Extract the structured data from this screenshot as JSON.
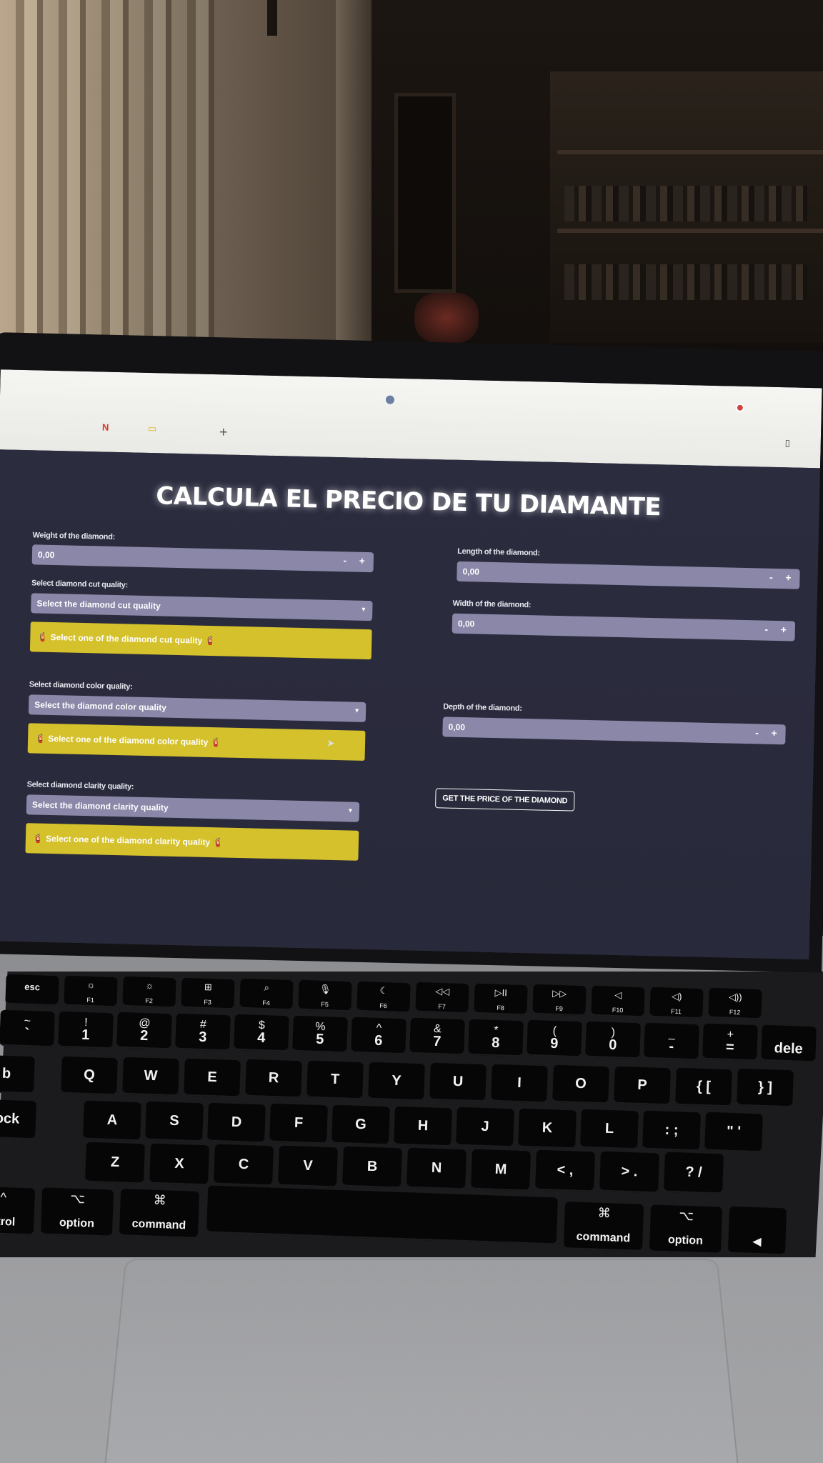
{
  "browser": {
    "tab_icon_1": "N",
    "tab_icon_2": "▭",
    "new_tab": "+",
    "toolbar_end": "▯"
  },
  "app": {
    "title": "CALCULA EL PRECIO DE TU DIAMANTE",
    "weight": {
      "label": "Weight of the diamond:",
      "value": "0,00"
    },
    "cut": {
      "label": "Select diamond cut quality:",
      "placeholder": "Select the diamond cut quality",
      "warning": "Select one of the diamond cut quality"
    },
    "color": {
      "label": "Select diamond color quality:",
      "placeholder": "Select the diamond color quality",
      "warning": "Select one of the diamond color quality"
    },
    "clarity": {
      "label": "Select diamond clarity quality:",
      "placeholder": "Select the diamond clarity quality",
      "warning": "Select one of the diamond clarity quality"
    },
    "length": {
      "label": "Length of the diamond:",
      "value": "0,00"
    },
    "width": {
      "label": "Width of the diamond:",
      "value": "0,00"
    },
    "depth": {
      "label": "Depth of the diamond:",
      "value": "0,00"
    },
    "stepper": {
      "minus": "-",
      "plus": "+"
    },
    "chevron": "▾",
    "button": "GET THE PRICE OF THE DIAMOND",
    "warning_icon": "🧯"
  },
  "keyboard": {
    "fn_row": [
      {
        "label": "esc",
        "sub": ""
      },
      {
        "label": "☼",
        "sub": "F1"
      },
      {
        "label": "☼",
        "sub": "F2"
      },
      {
        "label": "⊞",
        "sub": "F3"
      },
      {
        "label": "⌕",
        "sub": "F4"
      },
      {
        "label": "🎙",
        "sub": "F5"
      },
      {
        "label": "☾",
        "sub": "F6"
      },
      {
        "label": "◁◁",
        "sub": "F7"
      },
      {
        "label": "▷II",
        "sub": "F8"
      },
      {
        "label": "▷▷",
        "sub": "F9"
      },
      {
        "label": "◁",
        "sub": "F10"
      },
      {
        "label": "◁)",
        "sub": "F11"
      },
      {
        "label": "◁))",
        "sub": "F12"
      }
    ],
    "num_row": [
      {
        "top": "~",
        "bot": "`"
      },
      {
        "top": "!",
        "bot": "1"
      },
      {
        "top": "@",
        "bot": "2"
      },
      {
        "top": "#",
        "bot": "3"
      },
      {
        "top": "$",
        "bot": "4"
      },
      {
        "top": "%",
        "bot": "5"
      },
      {
        "top": "^",
        "bot": "6"
      },
      {
        "top": "&",
        "bot": "7"
      },
      {
        "top": "*",
        "bot": "8"
      },
      {
        "top": "(",
        "bot": "9"
      },
      {
        "top": ")",
        "bot": "0"
      },
      {
        "top": "_",
        "bot": "-"
      },
      {
        "top": "+",
        "bot": "="
      },
      {
        "top": "",
        "bot": "dele"
      }
    ],
    "row_q": [
      "b",
      "Q",
      "W",
      "E",
      "R",
      "T",
      "Y",
      "U",
      "I",
      "O",
      "P",
      "{ [",
      "} ]"
    ],
    "row_a": [
      "ock",
      "A",
      "S",
      "D",
      "F",
      "G",
      "H",
      "J",
      "K",
      "L",
      ": ;",
      "\" '"
    ],
    "row_z": [
      "Z",
      "X",
      "C",
      "V",
      "B",
      "N",
      "M",
      "< ,",
      "> .",
      "? /"
    ],
    "bottom_row": [
      {
        "sym": "^",
        "label": "ntrol"
      },
      {
        "sym": "⌥",
        "label": "option"
      },
      {
        "sym": "⌘",
        "label": "command"
      },
      {
        "sym": "⌘",
        "label": "command"
      },
      {
        "sym": "⌥",
        "label": "option"
      },
      {
        "sym": "",
        "label": "◀"
      }
    ]
  }
}
